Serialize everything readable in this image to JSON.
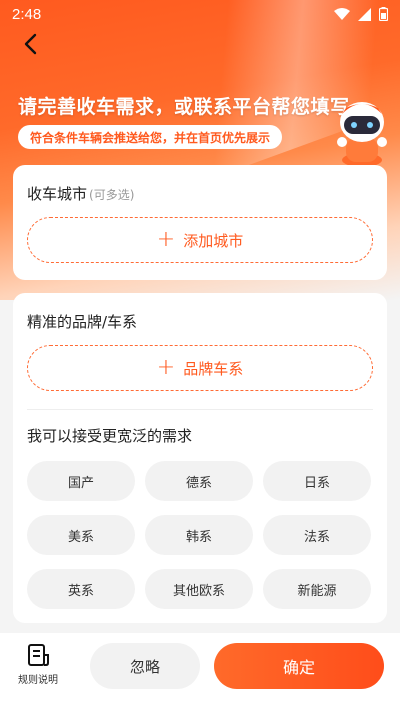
{
  "status_bar": {
    "time": "2:48"
  },
  "header": {
    "title": "请完善收车需求，或联系平台帮您填写",
    "subtitle": "符合条件车辆会推送给您，并在首页优先展示"
  },
  "city_section": {
    "title": "收车城市",
    "hint": "(可多选)",
    "add_label": "添加城市"
  },
  "brand_section": {
    "title": "精准的品牌/车系",
    "add_label": "品牌车系"
  },
  "broad_section": {
    "title": "我可以接受更宽泛的需求",
    "tags": [
      "国产",
      "德系",
      "日系",
      "美系",
      "韩系",
      "法系",
      "英系",
      "其他欧系",
      "新能源"
    ]
  },
  "bottom": {
    "rules_label": "规则说明",
    "ignore_label": "忽略",
    "confirm_label": "确定"
  },
  "colors": {
    "accent": "#ff5a1f",
    "tag_bg": "#f2f2f2"
  }
}
